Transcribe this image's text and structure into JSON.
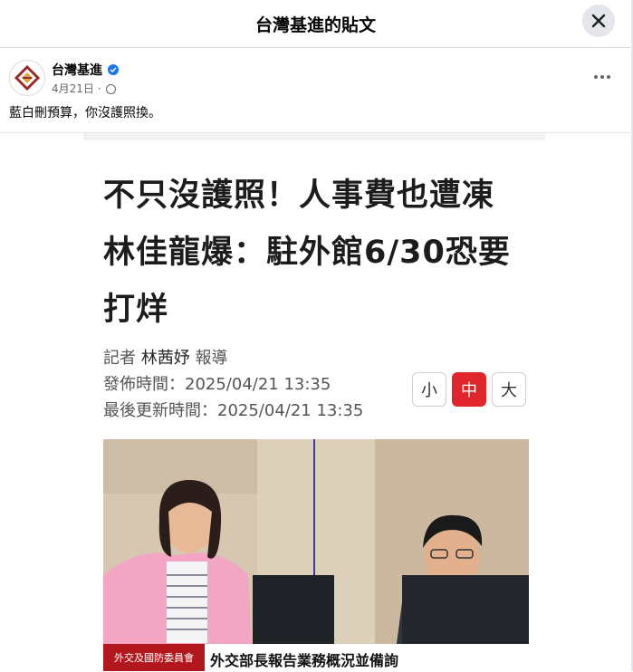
{
  "dialog": {
    "title": "台灣基進的貼文",
    "close_icon": "close-icon"
  },
  "post": {
    "author": "台灣基進",
    "date": "4月21日 ·",
    "caption": "藍白刪預算，你沒護照換。",
    "verified": true
  },
  "article": {
    "headline": "不只沒護照！人事費也遭凍　林佳龍爆：駐外館6/30恐要打烊",
    "reporter_label": "記者",
    "reporter_name": "林茜妤",
    "report_suffix": "報導",
    "published": "發佈時間：2025/04/21 13:35",
    "updated": "最後更新時間：2025/04/21 13:35",
    "font_sizes": [
      "小",
      "中",
      "大"
    ],
    "active_font_size": "中",
    "photo": {
      "banner_left": "外交及國防委員會",
      "banner_text": "外交部長報告業務概況並備詢"
    }
  },
  "colors": {
    "accent": "#e0262c",
    "verified": "#1877f2",
    "banner": "#b2171d"
  }
}
